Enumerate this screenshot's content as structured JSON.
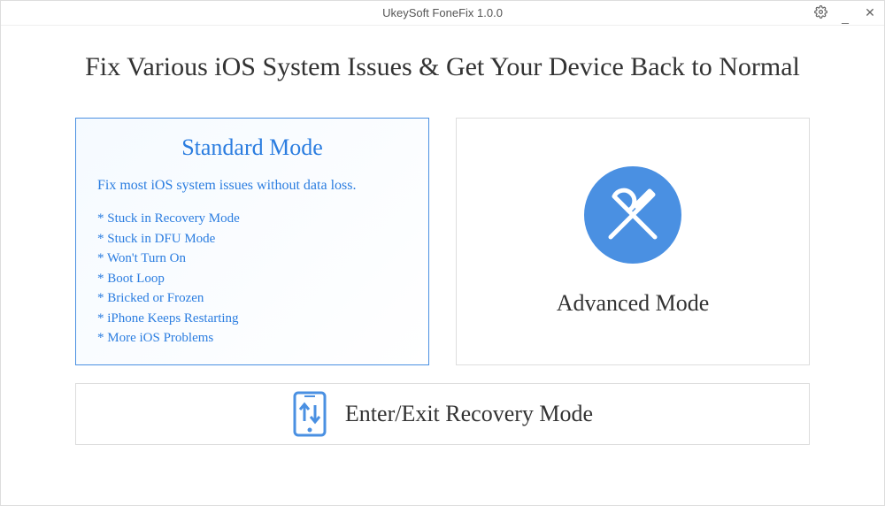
{
  "window": {
    "title": "UkeySoft FoneFix 1.0.0"
  },
  "heading": "Fix Various iOS System Issues & Get Your Device Back to Normal",
  "standardMode": {
    "title": "Standard Mode",
    "description": "Fix most iOS system issues without data loss.",
    "items": [
      "* Stuck in Recovery Mode",
      "* Stuck in DFU Mode",
      "* Won't Turn On",
      "* Boot Loop",
      "* Bricked or Frozen",
      "* iPhone Keeps Restarting",
      "* More iOS Problems"
    ]
  },
  "advancedMode": {
    "title": "Advanced Mode"
  },
  "recoveryMode": {
    "title": "Enter/Exit Recovery Mode"
  },
  "colors": {
    "accent": "#4a90e2",
    "textBlue": "#2b7de0"
  }
}
